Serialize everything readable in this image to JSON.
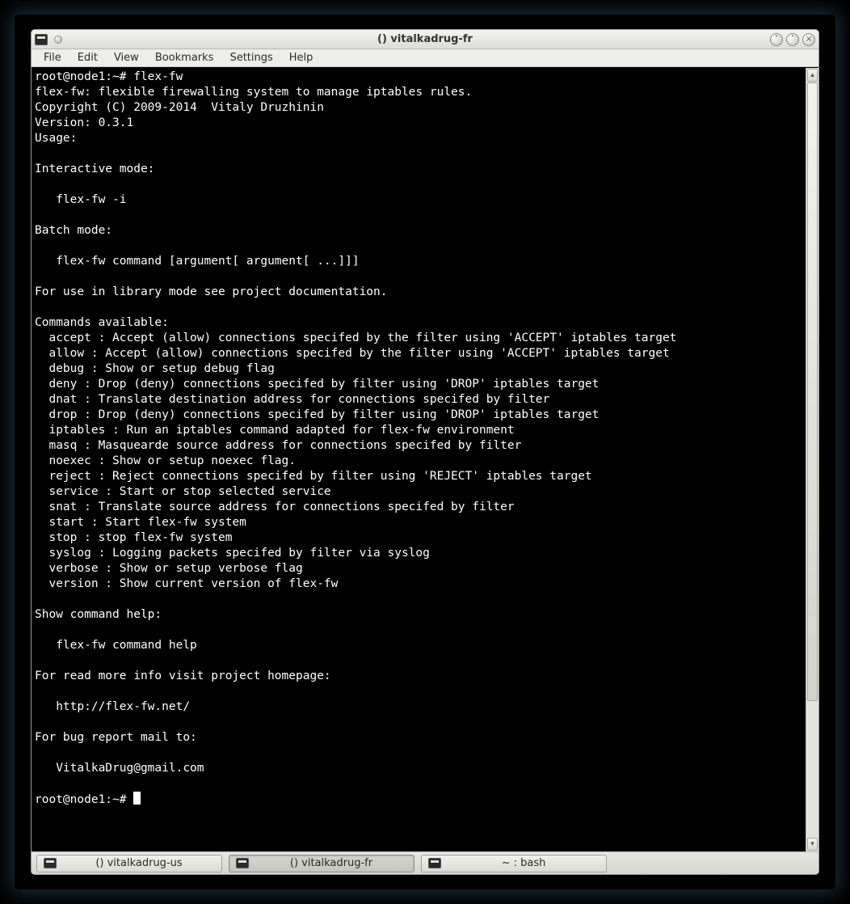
{
  "window": {
    "title": "() vitalkadrug-fr"
  },
  "menu": {
    "items": [
      "File",
      "Edit",
      "View",
      "Bookmarks",
      "Settings",
      "Help"
    ]
  },
  "terminal": {
    "prompt1": "root@node1:~# ",
    "cmd1": "flex-fw",
    "lines": [
      "flex-fw: flexible firewalling system to manage iptables rules.",
      "Copyright (C) 2009-2014  Vitaly Druzhinin",
      "Version: 0.3.1",
      "Usage:",
      "",
      "Interactive mode:",
      "",
      "   flex-fw -i",
      "",
      "Batch mode:",
      "",
      "   flex-fw command [argument[ argument[ ...]]]",
      "",
      "For use in library mode see project documentation.",
      "",
      "Commands available:",
      "  accept : Accept (allow) connections specifed by the filter using 'ACCEPT' iptables target",
      "  allow : Accept (allow) connections specifed by the filter using 'ACCEPT' iptables target",
      "  debug : Show or setup debug flag",
      "  deny : Drop (deny) connections specifed by filter using 'DROP' iptables target",
      "  dnat : Translate destination address for connections specifed by filter",
      "  drop : Drop (deny) connections specifed by filter using 'DROP' iptables target",
      "  iptables : Run an iptables command adapted for flex-fw environment",
      "  masq : Masquearde source address for connections specifed by filter",
      "  noexec : Show or setup noexec flag.",
      "  reject : Reject connections specifed by filter using 'REJECT' iptables target",
      "  service : Start or stop selected service",
      "  snat : Translate source address for connections specifed by filter",
      "  start : Start flex-fw system",
      "  stop : stop flex-fw system",
      "  syslog : Logging packets specifed by filter via syslog",
      "  verbose : Show or setup verbose flag",
      "  version : Show current version of flex-fw",
      "",
      "Show command help:",
      "",
      "   flex-fw command help",
      "",
      "For read more info visit project homepage:",
      "",
      "   http://flex-fw.net/",
      "",
      "For bug report mail to:",
      "",
      "   VitalkaDrug@gmail.com",
      ""
    ],
    "prompt2": "root@node1:~# "
  },
  "taskbar": {
    "items": [
      {
        "label": "() vitalkadrug-us",
        "active": false
      },
      {
        "label": "() vitalkadrug-fr",
        "active": true
      },
      {
        "label": "~ : bash",
        "active": false
      }
    ]
  }
}
